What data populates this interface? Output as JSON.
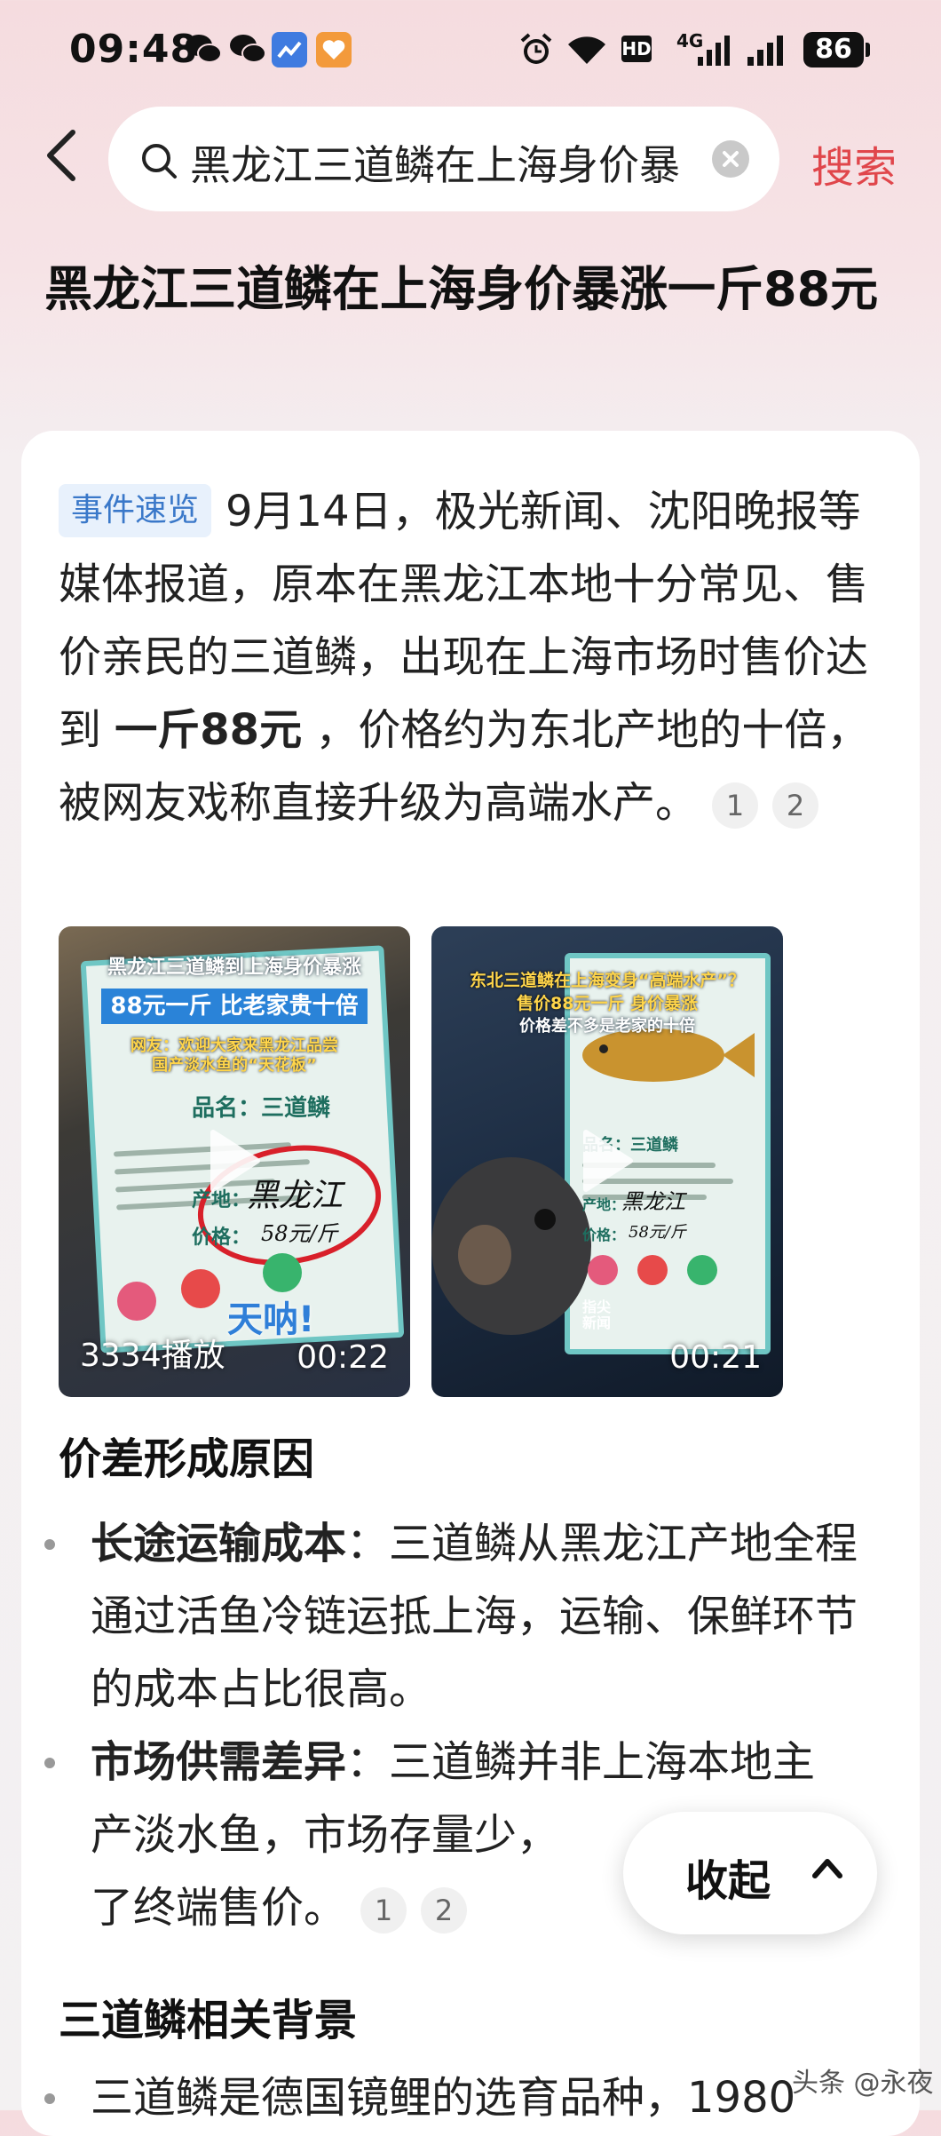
{
  "status_bar": {
    "time": "09:48",
    "network_hd": "HD",
    "network_4g": "4G",
    "battery": "86"
  },
  "search": {
    "query": "黑龙江三道鳞在上海身价暴",
    "search_button": "搜索"
  },
  "article": {
    "title": "黑龙江三道鳞在上海身价暴涨一斤88元",
    "event_tag": "事件速览",
    "intro_before_bold": "9月14日，极光新闻、沈阳晚报等媒体报道，原本在黑龙江本地十分常见、售价亲民的三道鳞，出现在上海市场时售价达到 ",
    "intro_bold": "一斤88元",
    "intro_after_bold": " ，价格约为东北产地的十倍，被网友戏称直接升级为高端水产。",
    "intro_refs": [
      "1",
      "2"
    ],
    "videos": [
      {
        "title_line": "黑龙江三道鳞到上海身价暴涨",
        "box_line": "88元一斤 比老家贵十倍",
        "sub_line1": "网友：欢迎大家来黑龙江品尝",
        "sub_line2": "国产淡水鱼的“天花板”",
        "sign_name": "品名：三道鳞",
        "sign_origin_label": "产地：",
        "sign_origin_hand": "黑龙江",
        "sign_price_label": "价格：",
        "sign_price_hand": "58元/斤",
        "sticker": "天呐!",
        "plays": "3334播放",
        "duration": "00:22"
      },
      {
        "title_line": "东北三道鳞在上海变身“高端水产”？",
        "box_line": "售价88元一斤 身价暴涨",
        "sub_line1": "价格差不多是老家的十倍",
        "sign_name": "品名：三道鳞",
        "sign_origin_label": "产地：",
        "sign_origin_hand": "黑龙江",
        "sign_price_label": "价格：",
        "sign_price_hand": "58元/斤",
        "logo": "指尖新闻",
        "duration": "00:21"
      }
    ],
    "section1_heading": "价差形成原因",
    "bullets": [
      {
        "bold": "长途运输成本",
        "text": "：三道鳞从黑龙江产地全程通过活鱼冷链运抵上海，运输、保鲜环节的成本占比很高。"
      },
      {
        "bold": "市场供需差异",
        "text": "：三道鳞并非上海本地主产淡水鱼，市场存量少，",
        "text_tail": "了终端售价。",
        "refs": [
          "1",
          "2"
        ]
      }
    ],
    "section2_heading": "三道鳞相关背景",
    "section2_first_line": "三道鳞是德国镜鲤的选育品种，1980"
  },
  "collapse_button": "收起",
  "watermark": "头条 @永夜"
}
